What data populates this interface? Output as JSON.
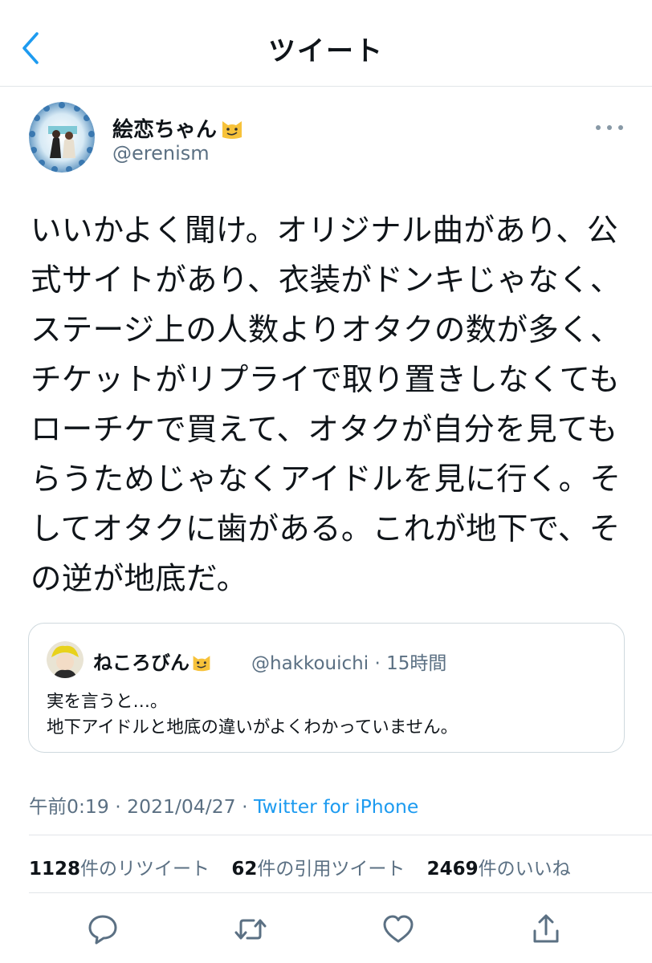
{
  "header": {
    "title": "ツイート",
    "back_icon": "chevron-left-icon"
  },
  "author": {
    "display_name": "絵恋ちゃん",
    "handle": "@erenism",
    "name_emoji": "smirking-cat-emoji"
  },
  "tweet": {
    "lines": [
      "いいかよく聞け。オリジナル曲があり、公",
      "式サイトがあり、衣装がドンキじゃなく、",
      "ステージ上の人数よりオタクの数が多く、",
      "チケットがリプライで取り置きしなくても",
      "ローチケで買えて、オタクが自分を見ても",
      "らうためじゃなくアイドルを見に行く。そ",
      "してオタクに歯がある。これが地下で、そ",
      "の逆が地底だ。"
    ]
  },
  "quote": {
    "display_name": "ねころびん",
    "handle_time": "@hakkouichi · 15時間",
    "line1": "実を言うと…。",
    "line2": "地下アイドルと地底の違いがよくわかっていません。"
  },
  "meta": {
    "time_date": "午前0:19 · 2021/04/27 · ",
    "source": "Twitter for iPhone"
  },
  "stats": {
    "retweets_count": "1128",
    "retweets_label": "件のリツイート",
    "quotes_count": "62",
    "quotes_label": "件の引用ツイート",
    "likes_count": "2469",
    "likes_label": "件のいいね"
  },
  "actions": [
    "reply-icon",
    "retweet-icon",
    "like-icon",
    "share-icon"
  ],
  "colors": {
    "accent": "#1d9bf0",
    "secondary_text": "#5b7083",
    "border": "#e1e5e8"
  }
}
